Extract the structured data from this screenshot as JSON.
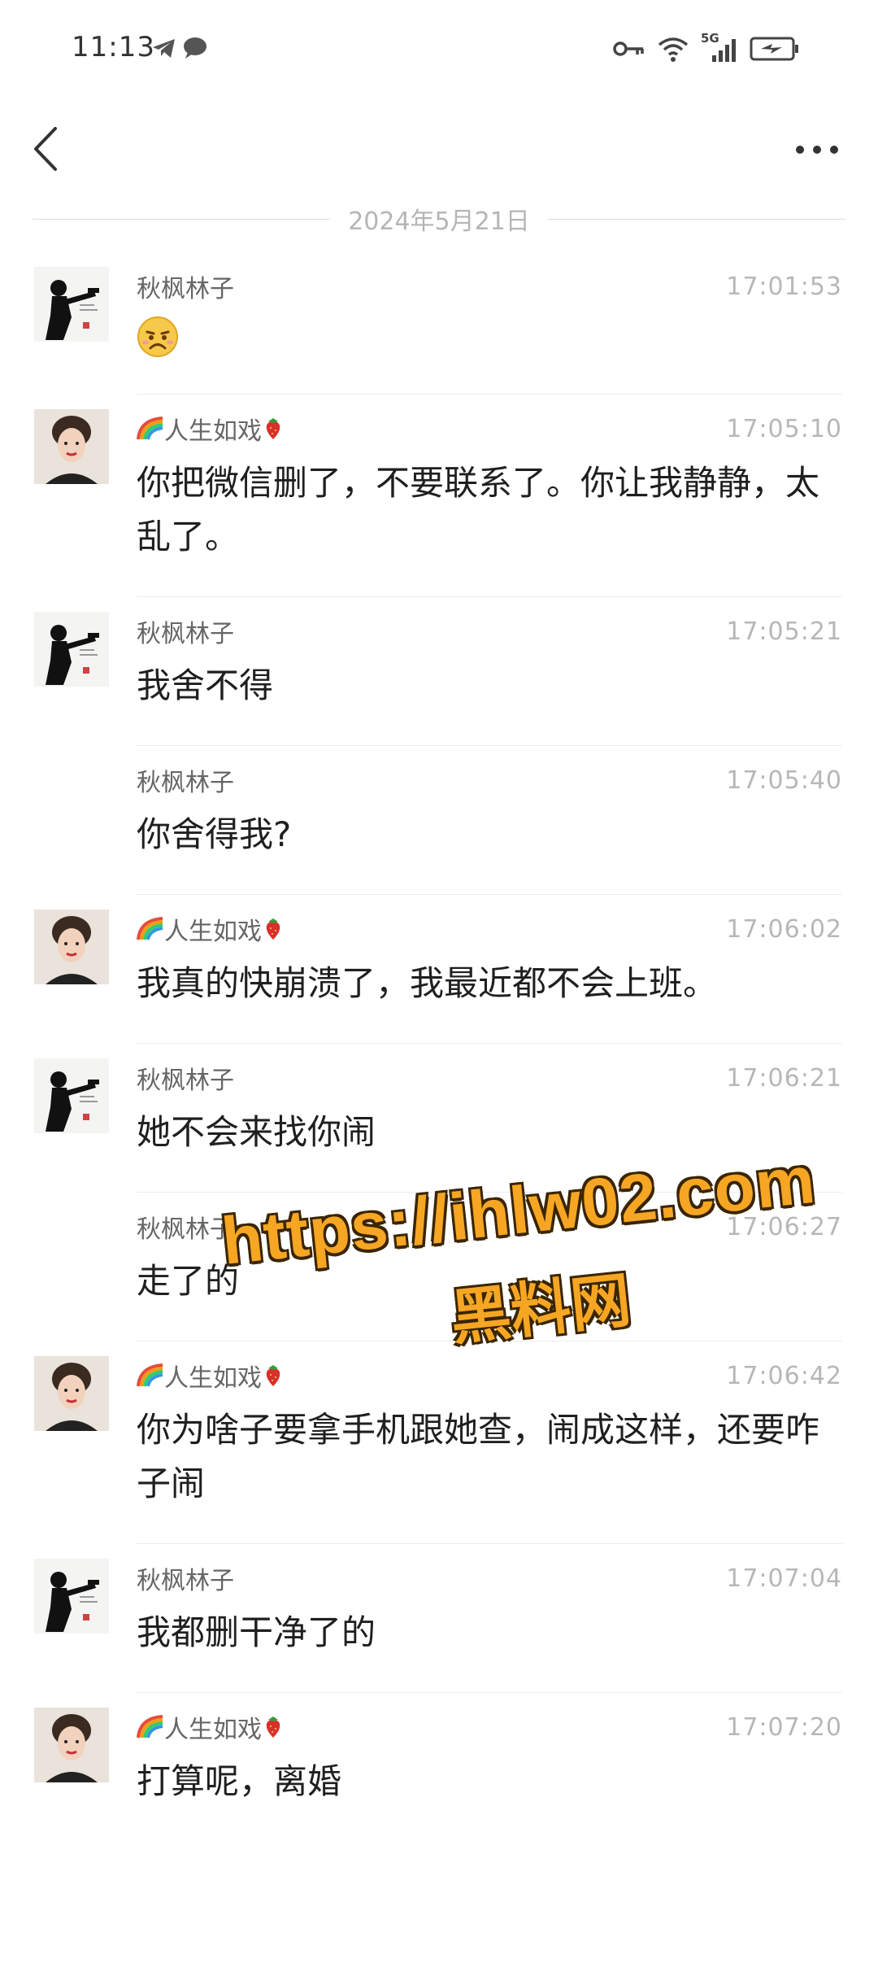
{
  "status_bar": {
    "time": "11:13",
    "left_icons": [
      "telegram-icon",
      "chat-bubble-icon"
    ],
    "right_icons": [
      "key-icon",
      "wifi-icon",
      "signal-5g-icon",
      "battery-charging-icon"
    ],
    "network_label": "5G"
  },
  "nav": {
    "back_icon": "chevron-left-icon",
    "more_icon": "more-dots-icon"
  },
  "date_divider": "2024年5月21日",
  "messages": [
    {
      "sender": "秋枫林子",
      "time": "17:01:53",
      "text": "",
      "emoji": "sad-face",
      "avatar": "man-gun-avatar"
    },
    {
      "sender": "人生如戏",
      "time": "17:05:10",
      "text": "你把微信删了，不要联系了。你让我静静，太乱了。",
      "avatar": "woman-avatar"
    },
    {
      "sender": "秋枫林子",
      "time": "17:05:21",
      "text": "我舍不得",
      "avatar": "man-gun-avatar"
    },
    {
      "sender": "秋枫林子",
      "time": "17:05:40",
      "text": "你舍得我?",
      "avatar": ""
    },
    {
      "sender": "人生如戏",
      "time": "17:06:02",
      "text": "我真的快崩溃了，我最近都不会上班。",
      "avatar": "woman-avatar"
    },
    {
      "sender": "秋枫林子",
      "time": "17:06:21",
      "text": "她不会来找你闹",
      "avatar": "man-gun-avatar"
    },
    {
      "sender": "秋枫林子",
      "time": "17:06:27",
      "text": "走了的",
      "avatar": ""
    },
    {
      "sender": "人生如戏",
      "time": "17:06:42",
      "text": "你为啥子要拿手机跟她查，闹成这样，还要咋子闹",
      "avatar": "woman-avatar"
    },
    {
      "sender": "秋枫林子",
      "time": "17:07:04",
      "text": "我都删干净了的",
      "avatar": "man-gun-avatar"
    },
    {
      "sender": "人生如戏",
      "time": "17:07:20",
      "text": "打算呢，离婚",
      "avatar": "woman-avatar"
    }
  ],
  "watermark": {
    "url": "https://ihlw02.com",
    "label": "黑料网"
  },
  "colors": {
    "watermark_fill": "#f6a623",
    "watermark_outline": "#3a2500",
    "time_text": "#b7b7b7",
    "sender_text": "#666666"
  }
}
